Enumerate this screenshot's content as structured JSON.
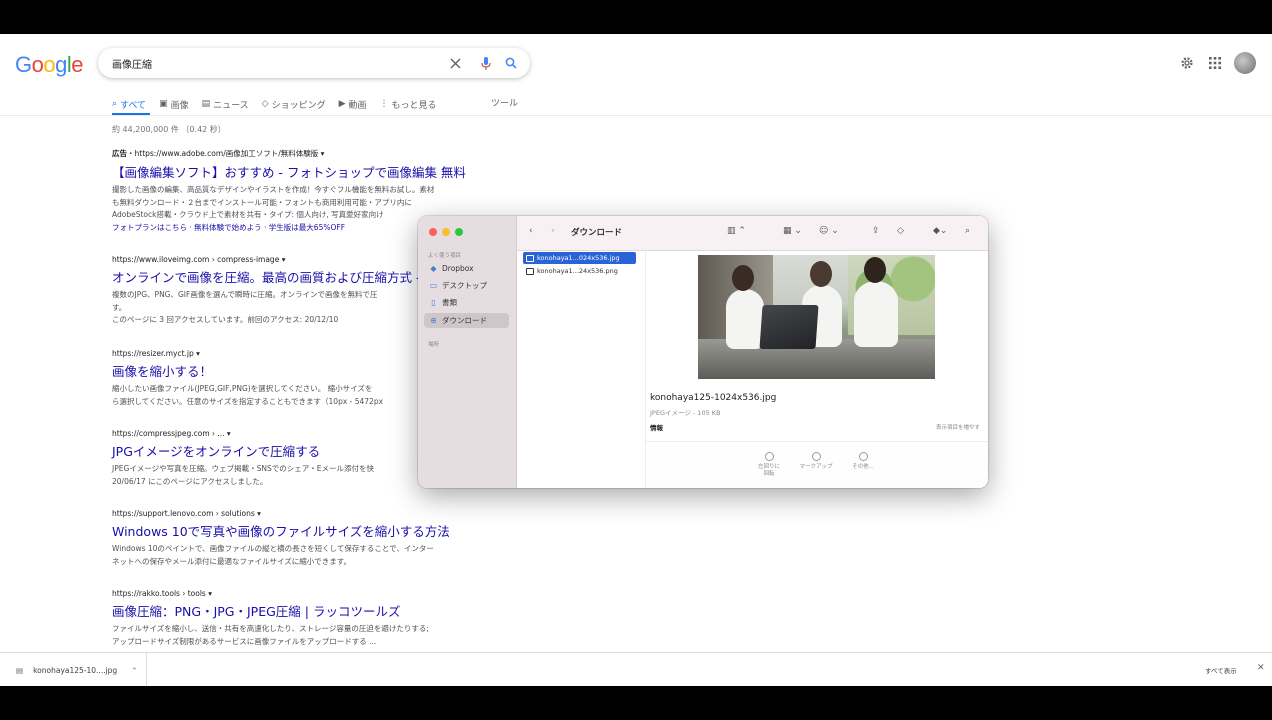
{
  "search": {
    "query": "画像圧縮"
  },
  "logo": [
    "G",
    "o",
    "o",
    "g",
    "l",
    "e"
  ],
  "logo_colors": [
    "#4285f4",
    "#ea4335",
    "#fbbc05",
    "#4285f4",
    "#34a853",
    "#ea4335"
  ],
  "tabs": [
    {
      "label": "すべて",
      "icon": "search-icon"
    },
    {
      "label": "画像",
      "icon": "image-icon"
    },
    {
      "label": "ニュース",
      "icon": "news-icon"
    },
    {
      "label": "ショッピング",
      "icon": "tag-icon"
    },
    {
      "label": "動画",
      "icon": "video-icon"
    },
    {
      "label": "もっと見る",
      "icon": "more-icon"
    }
  ],
  "tools_label": "ツール",
  "stats": "約 44,200,000 件 （0.42 秒）",
  "results": [
    {
      "ad_label": "広告",
      "cite": "・https://www.adobe.com/画像加工ソフト/無料体験版 ▾",
      "title": "【画像編集ソフト】おすすめ - フォトショップで画像編集 無料",
      "snippet": [
        "撮影した画像の編集、高品質なデザインやイラストを作成！今すぐフル機能を無料お試し。素材",
        "も無料ダウンロード・２台までインストール可能・フォントも商用利用可能・アプリ内に",
        "AdobeStock搭載・クラウド上で素材を共有・タイプ: 個人向け, 写真愛好家向け"
      ],
      "links": "フォトプランはこちら · 無料体験で始めよう · 学生版は最大65%OFF"
    },
    {
      "cite": "https://www.iloveimg.com › compress-image ▾",
      "title": "オンラインで画像を圧縮。最高の画質および圧縮方式 - ...",
      "snippet": [
        "複数のJPG、PNG、GIF画像を選んで瞬時に圧縮。オンラインで画像を無料で圧",
        "す。",
        "このページに 3 回アクセスしています。前回のアクセス: 20/12/10"
      ]
    },
    {
      "cite": "https://resizer.myct.jp ▾",
      "title": "画像を縮小する！",
      "snippet": [
        "縮小したい画像ファイル(JPEG,GIF,PNG)を選択してください。 縮小サイズを",
        "ら選択してください。任意のサイズを指定することもできます（10px - 5472px"
      ]
    },
    {
      "cite": "https://compressjpeg.com › ... ▾",
      "title": "JPGイメージをオンラインで圧縮する",
      "snippet": [
        "JPEGイメージや写真を圧縮。ウェブ掲載・SNSでのシェア・Eメール添付を快",
        "20/06/17 にこのページにアクセスしました。"
      ]
    },
    {
      "cite": "https://support.lenovo.com › solutions ▾",
      "title": "Windows 10で写真や画像のファイルサイズを縮小する方法",
      "snippet": [
        "Windows 10のペイントで、画像ファイルの縦と横の長さを短くして保存することで、インター",
        "ネットへの保存やメール添付に最適なファイルサイズに縮小できます。"
      ]
    },
    {
      "cite": "https://rakko.tools › tools ▾",
      "title": "画像圧縮：PNG・JPG・JPEG圧縮 | ラッコツールズ",
      "snippet": [
        "ファイルサイズを縮小し、送信・共有を高速化したり、ストレージ容量の圧迫を避けたりする;",
        "アップロードサイズ制限があるサービスに画像ファイルをアップロードする ..."
      ]
    }
  ],
  "finder": {
    "title": "ダウンロード",
    "sidebar_section_favorites": "よく使う項目",
    "sidebar_section_places": "場所",
    "sidebar_items": [
      "Dropbox",
      "デスクトップ",
      "書類",
      "ダウンロード"
    ],
    "files": [
      "konohaya1...024x536.jpg",
      "konohaya1...24x536.png"
    ],
    "preview_name": "konohaya125-1024x536.jpg",
    "preview_sub": "JPEGイメージ - 105 KB",
    "info_label": "情報",
    "show_more": "表示項目を増やす",
    "actions": [
      "左回りに\n回転",
      "マークアップ",
      "その他..."
    ]
  },
  "download_bar": {
    "file": "konohaya125-10....jpg",
    "show_all": "すべて表示",
    "close": "✕"
  }
}
